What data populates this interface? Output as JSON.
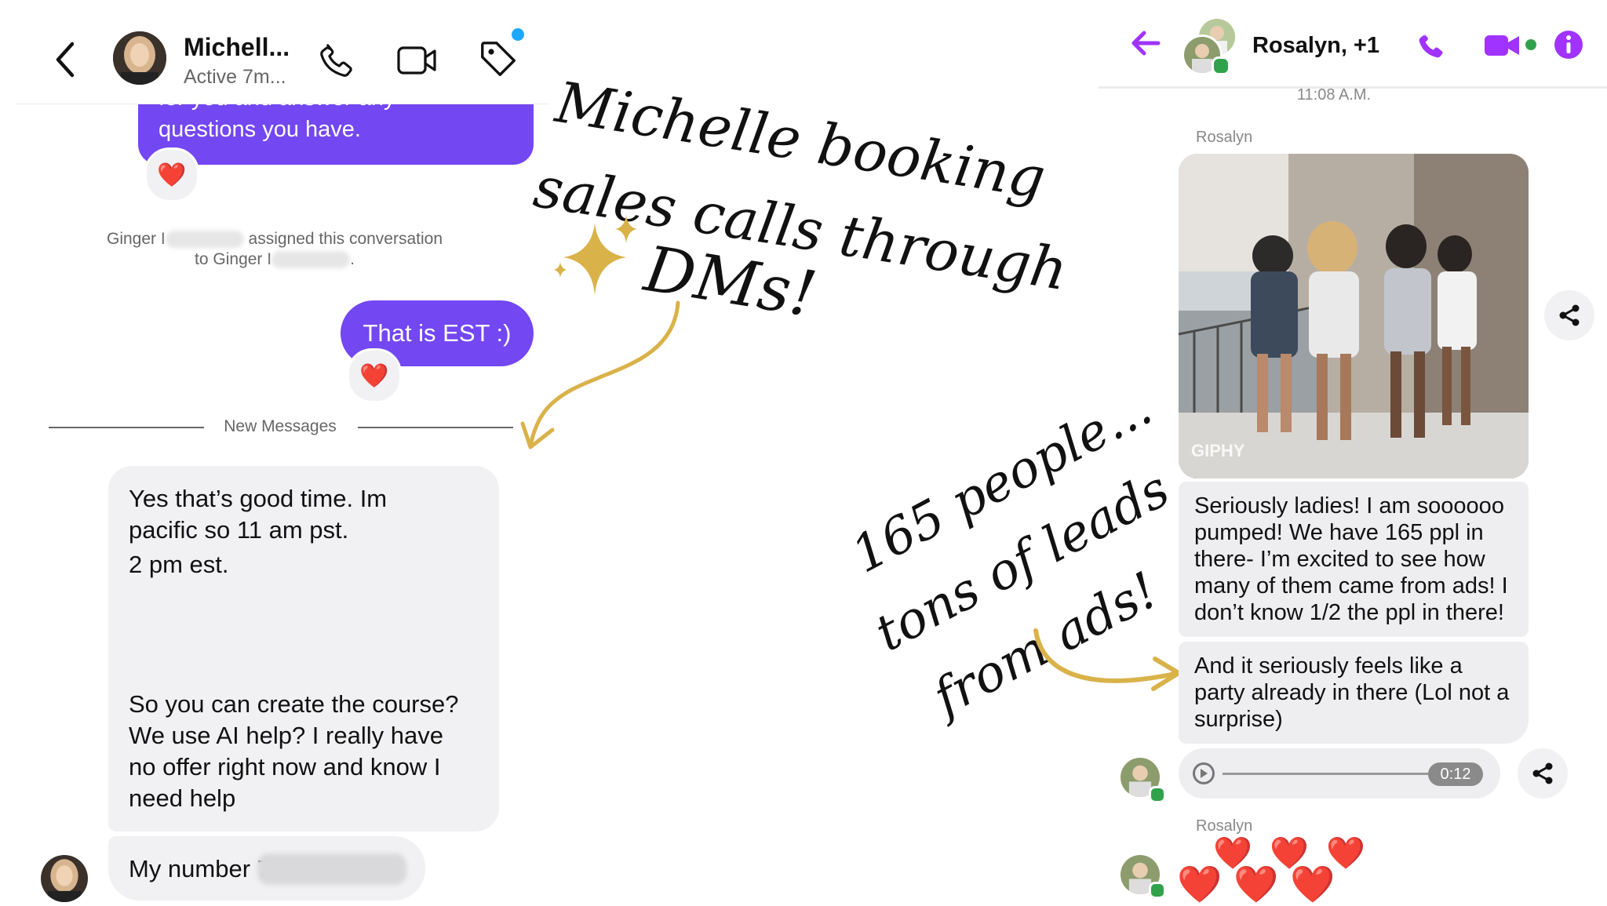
{
  "left_chat": {
    "contact_name": "Michell...",
    "status": "Active 7m...",
    "bubble_top": {
      "line1": "for you and answer any",
      "line2": "questions you have.",
      "reaction": "❤️"
    },
    "system_message": {
      "line1_start": "Ginger I",
      "line1_end": "assigned this conversation",
      "line2_start": "to Ginger I",
      "line2_end": "."
    },
    "bubble_est": {
      "text": "That is EST :)",
      "reaction": "❤️"
    },
    "divider_label": "New Messages",
    "incoming_1": {
      "line1": "Yes that’s good time. Im",
      "line2": "pacific so 11 am pst.",
      "line3": "2 pm est.",
      "line4": "So you can create the course?",
      "line5": "We use AI help? I really have",
      "line6": "no offer right now and know I",
      "line7": "need help"
    },
    "incoming_2": {
      "text": "My number 7"
    }
  },
  "annotations": {
    "top_line1": "Michelle booking",
    "top_line2": "sales calls through",
    "top_line3": "DMs!",
    "bottom_line1": "165 people...",
    "bottom_line2": "tons of leads",
    "bottom_line3": "from ads!"
  },
  "right_chat": {
    "contact_name": "Rosalyn, +1",
    "timestamp": "11:08 A.M.",
    "sender_label_1": "Rosalyn",
    "gif_watermark": "GIPHY",
    "message_1": {
      "line1": "Seriously ladies! I am soooooo",
      "line2": "pumped! We have 165 ppl in",
      "line3": "there- I’m excited to see how",
      "line4": "many of them came from ads! I",
      "line5": "don’t know 1/2 the ppl in there!"
    },
    "message_2": {
      "line1": "And it seriously feels like a",
      "line2": "party already in there (Lol not a",
      "line3": "surprise)"
    },
    "voice_duration": "0:12",
    "voice_progress": 0,
    "sender_label_2": "Rosalyn",
    "hearts": [
      "❤️",
      "❤️",
      "❤️",
      "❤️",
      "❤️",
      "❤️"
    ]
  },
  "colors": {
    "purple_bubble": "#7347f2",
    "messenger_purple": "#a033ff",
    "online_green": "#31a24c",
    "gold_accent": "#d9b24a",
    "notification_blue": "#1ea7ff"
  },
  "icons": [
    "back-chevron-icon",
    "phone-icon",
    "video-icon",
    "tag-icon",
    "back-arrow-icon",
    "info-icon",
    "share-icon",
    "play-icon",
    "heart-icon",
    "sparkle-icon"
  ]
}
